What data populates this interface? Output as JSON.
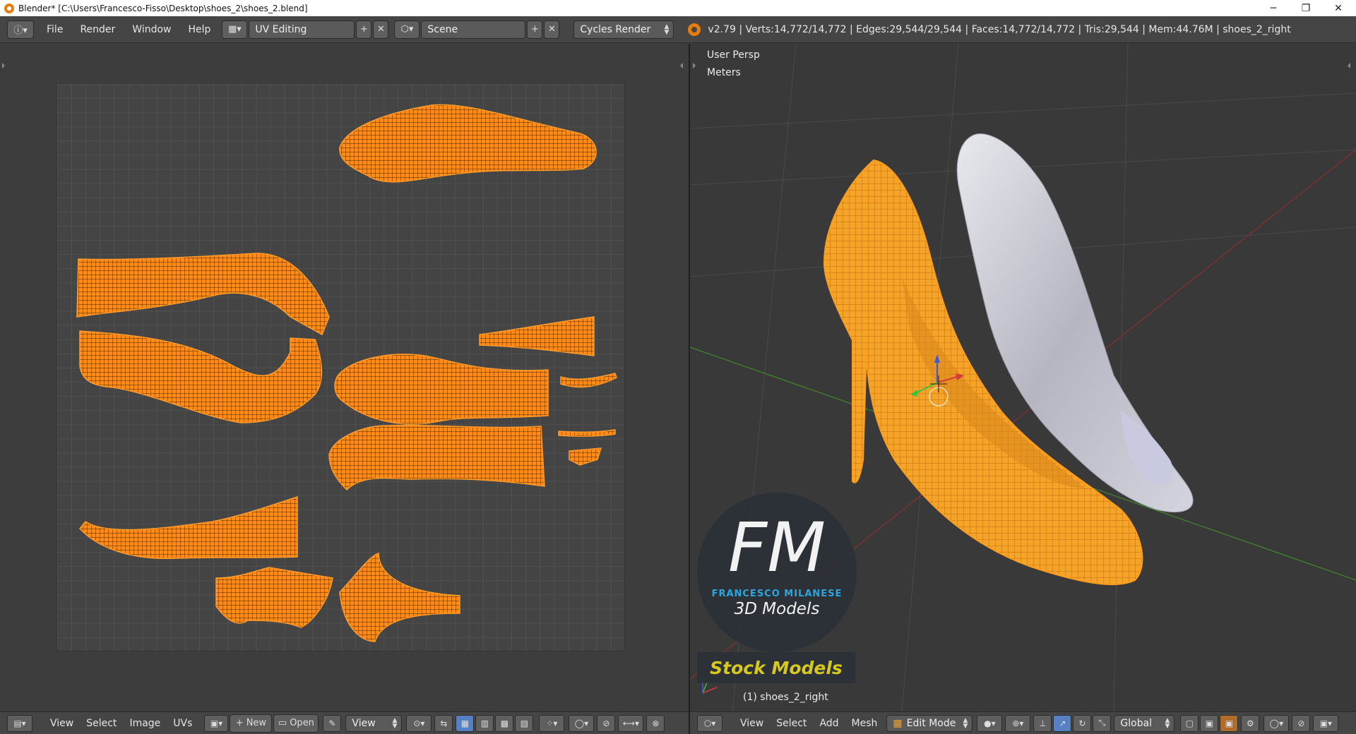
{
  "window": {
    "title": "Blender* [C:\\Users\\Francesco-Fisso\\Desktop\\shoes_2\\shoes_2.blend]",
    "minimize": "─",
    "restore": "❐",
    "close": "✕"
  },
  "topbar": {
    "menus": [
      "File",
      "Render",
      "Window",
      "Help"
    ],
    "screen_layout": "UV Editing",
    "scene": "Scene",
    "render_engine": "Cycles Render",
    "stats": "v2.79 | Verts:14,772/14,772 | Edges:29,544/29,544 | Faces:14,772/14,772 | Tris:29,544 | Mem:44.76M | shoes_2_right"
  },
  "viewport": {
    "view_label": "User Persp",
    "units_label": "Meters",
    "object_label": "(1) shoes_2_right",
    "watermark": {
      "monogram": "FM",
      "name": "FRANCESCO MILANESE",
      "subtitle": "3D Models",
      "badge": "Stock Models"
    }
  },
  "uv_bottombar": {
    "menus": [
      "View",
      "Select",
      "Image",
      "UVs"
    ],
    "new_label": "New",
    "open_label": "Open",
    "view_label": "View"
  },
  "view3d_bottombar": {
    "menus": [
      "View",
      "Select",
      "Add",
      "Mesh"
    ],
    "mode": "Edit Mode",
    "orientation": "Global"
  },
  "colors": {
    "uv_island": "#ff8c1a",
    "selection": "#ff9d1a",
    "accent_blue": "#5680c2",
    "watermark_blue": "#2aa7e0",
    "badge_yellow": "#d6c81c"
  }
}
